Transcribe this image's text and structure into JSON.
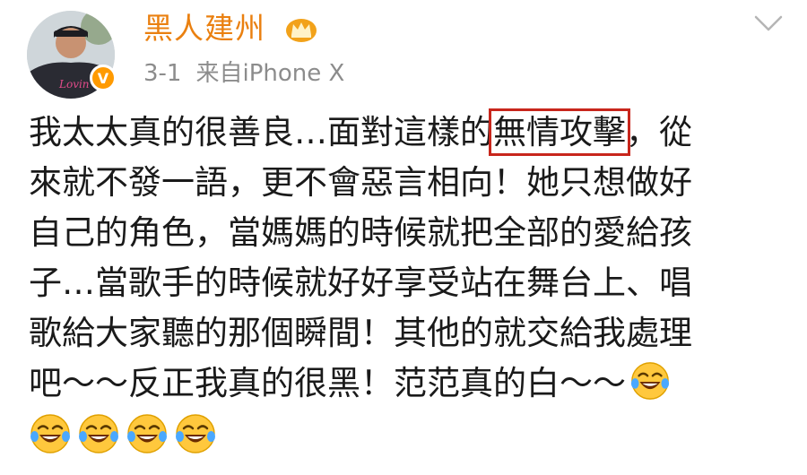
{
  "post": {
    "username": "黑人建州",
    "date": "3-1",
    "source": "来自iPhone X",
    "lines": {
      "l1_pre": "我太太真的很善良…面對這樣的",
      "l1_hl": "無情攻擊",
      "l1_post": "，從",
      "l2": "來就不發一語，更不會惡言相向！她只想做好",
      "l3": "自己的角色，當媽媽的時候就把全部的愛給孩",
      "l4": "子…當歌手的時候就好好享受站在舞台上、唱",
      "l5": "歌給大家聽的那個瞬間！其他的就交給我處理",
      "l6": "吧～～反正我真的很黑！范范真的白～～"
    },
    "emoji_icon": "laughing-with-tears-emoji",
    "emoji_count_trailing": 4
  },
  "icons": {
    "badge": "crown-badge-icon",
    "verified": "verified-badge-icon",
    "menu": "chevron-down-icon"
  },
  "colors": {
    "username": "#ea8010",
    "meta": "#8c8c8c",
    "text": "#1a1a1a",
    "highlight_border": "#c8261c",
    "verified": "#ff9a00"
  }
}
